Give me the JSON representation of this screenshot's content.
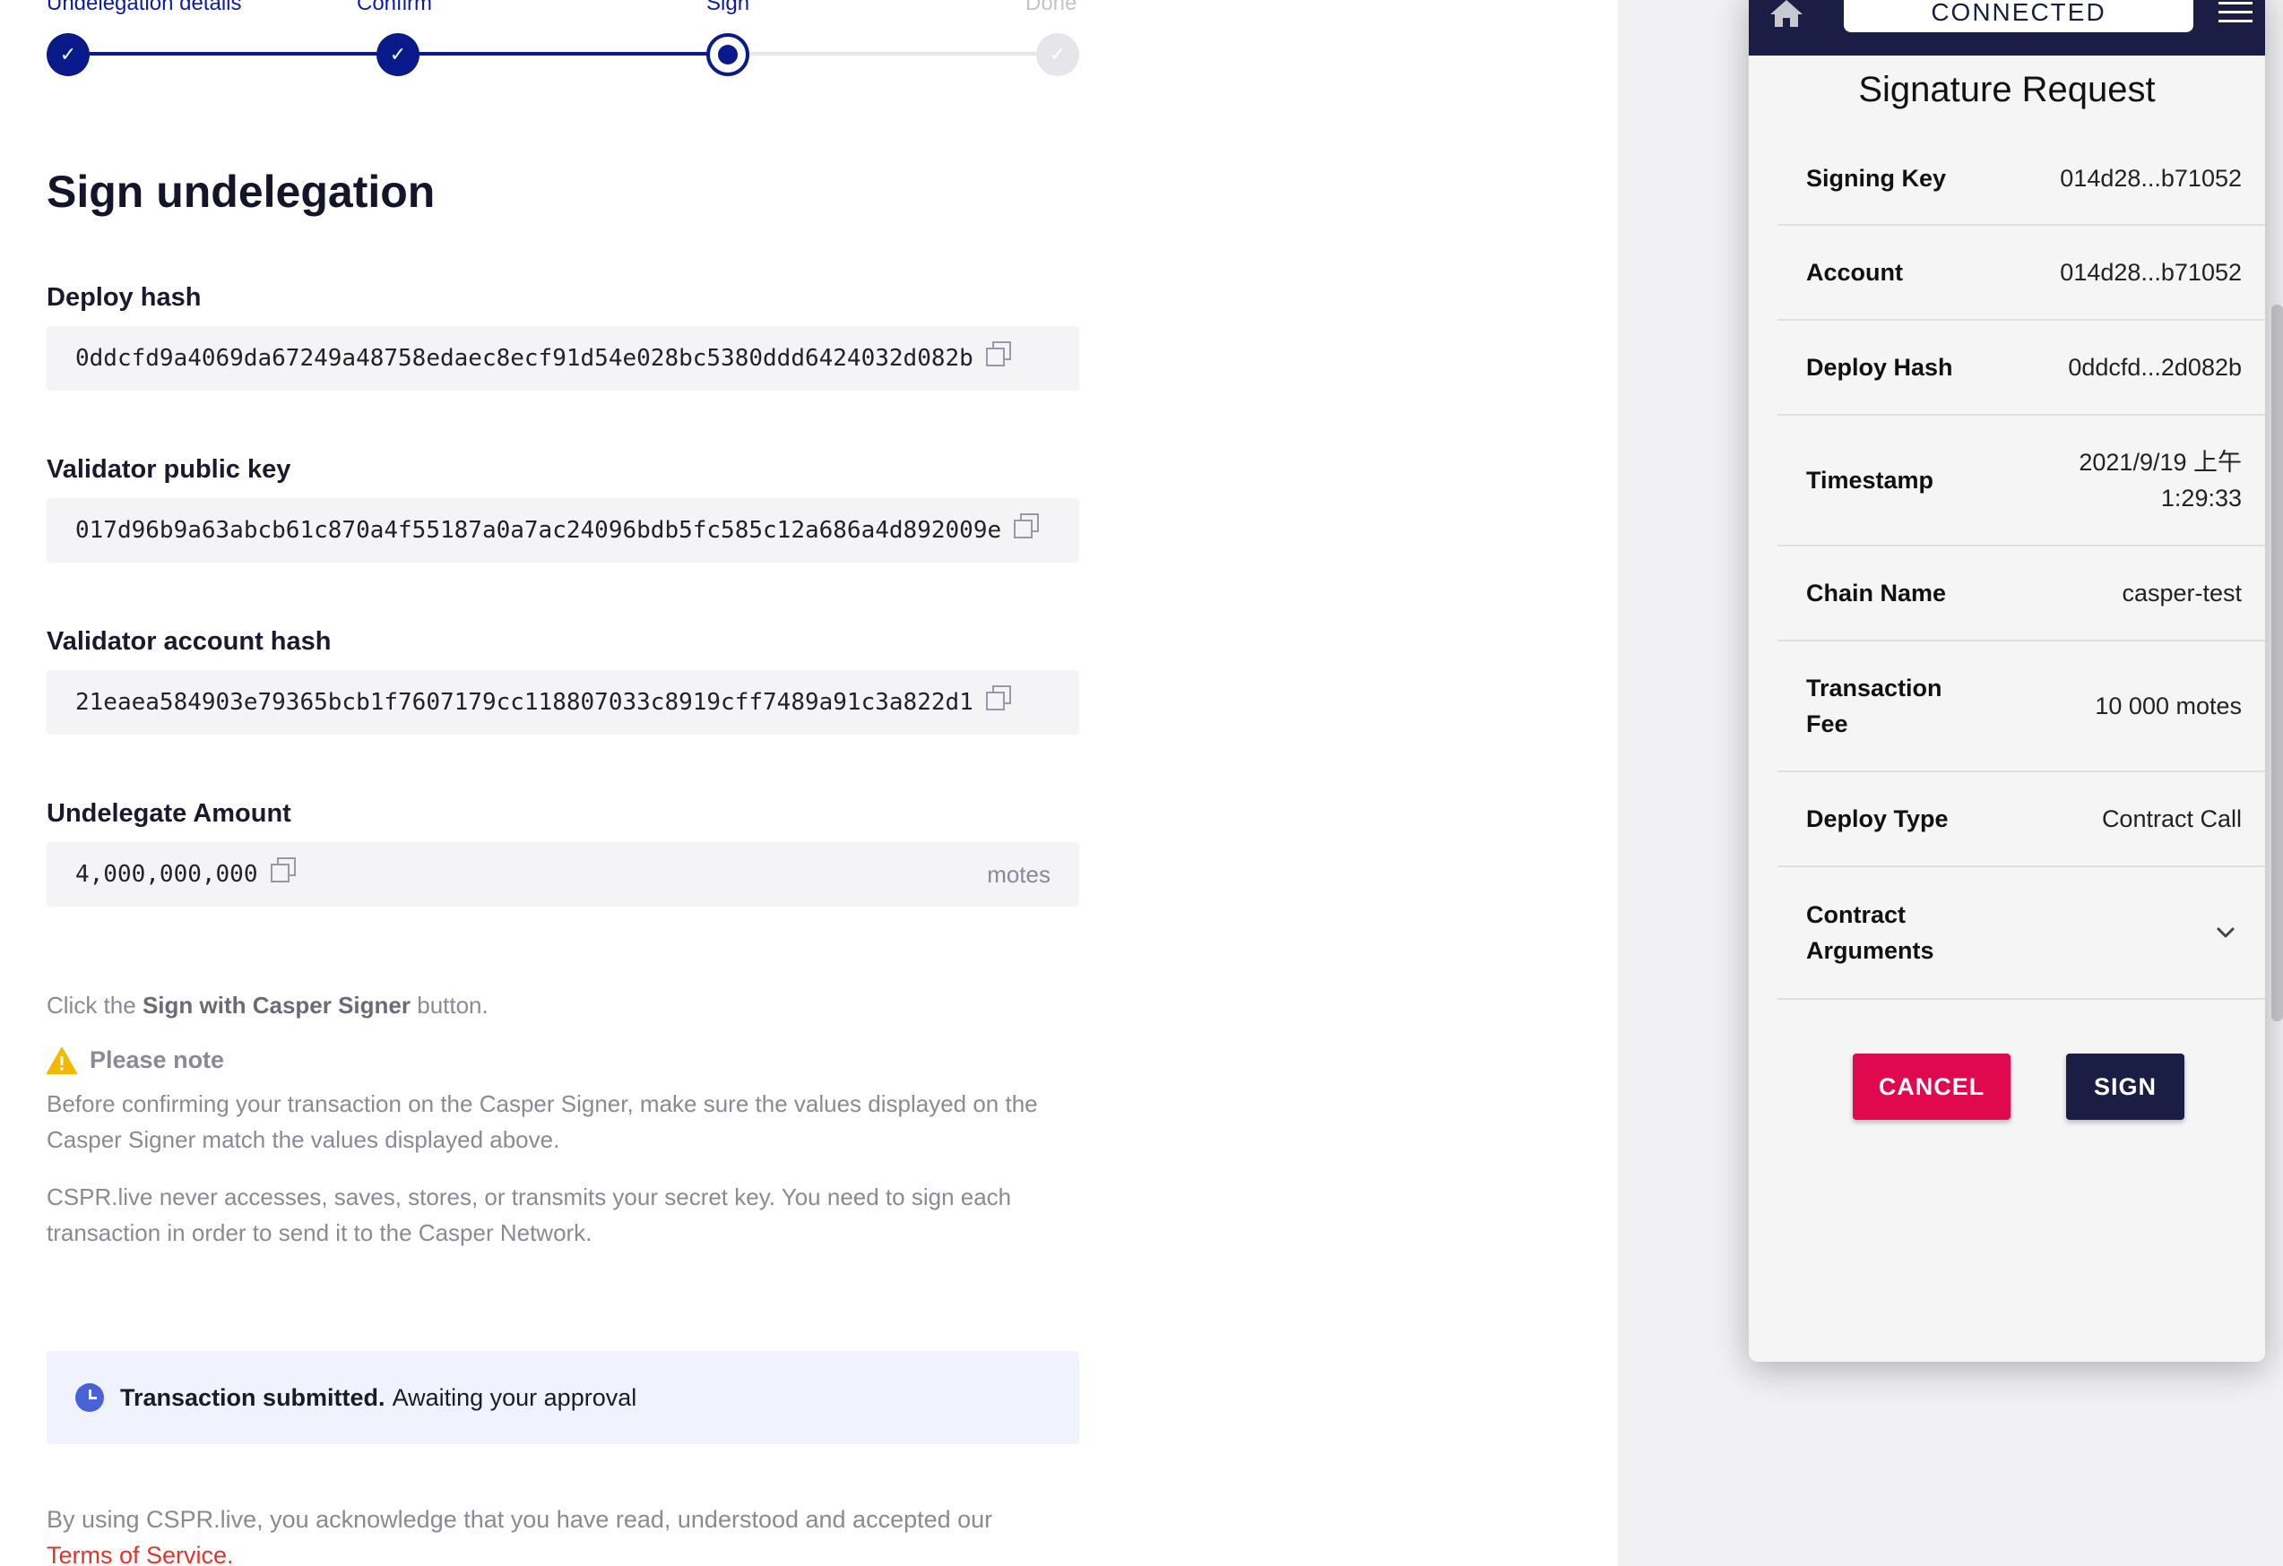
{
  "stepper": {
    "steps": [
      {
        "label": "Undelegation details",
        "state": "complete"
      },
      {
        "label": "Confirm",
        "state": "complete"
      },
      {
        "label": "Sign",
        "state": "current"
      },
      {
        "label": "Done",
        "state": "pending"
      }
    ]
  },
  "page": {
    "title": "Sign undelegation",
    "fields": {
      "deploy_hash_label": "Deploy hash",
      "deploy_hash": "0ddcfd9a4069da67249a48758edaec8ecf91d54e028bc5380ddd6424032d082b",
      "validator_public_key_label": "Validator public key",
      "validator_public_key": "017d96b9a63abcb61c870a4f55187a0a7ac24096bdb5fc585c12a686a4d892009e",
      "validator_account_hash_label": "Validator account hash",
      "validator_account_hash": "21eaea584903e79365bcb1f7607179cc118807033c8919cff7489a91c3a822d1",
      "undelegate_amount_label": "Undelegate Amount",
      "undelegate_amount": "4,000,000,000",
      "undelegate_amount_unit": "motes"
    },
    "instruction_prefix": "Click the",
    "instruction_button": "Sign with Casper Signer",
    "instruction_suffix": "button.",
    "note_title": "Please note",
    "note_p1": "Before confirming your transaction on the Casper Signer, make sure the values displayed on the Casper Signer match the values displayed above.",
    "note_p2": "CSPR.live never accesses, saves, stores, or transmits your secret key. You need to sign each transaction in order to send it to the Casper Network.",
    "status_bold": "Transaction submitted.",
    "status_text": "Awaiting your approval",
    "footer_text": "By using CSPR.live, you acknowledge that you have read, understood and accepted our",
    "footer_link": "Terms of Service."
  },
  "signer": {
    "connection": "CONNECTED",
    "title": "Signature Request",
    "rows": [
      {
        "key": "Signing Key",
        "value": "014d28...b71052"
      },
      {
        "key": "Account",
        "value": "014d28...b71052"
      },
      {
        "key": "Deploy Hash",
        "value": "0ddcfd...2d082b"
      },
      {
        "key": "Timestamp",
        "value_line1": "2021/9/19 上午",
        "value_line2": "1:29:33"
      },
      {
        "key": "Chain Name",
        "value": "casper-test"
      },
      {
        "key_line1": "Transaction",
        "key_line2": "Fee",
        "value": "10 000 motes"
      },
      {
        "key": "Deploy Type",
        "value": "Contract Call"
      },
      {
        "key_line1": "Contract",
        "key_line2": "Arguments",
        "icon": "chevron-down-icon"
      }
    ],
    "cancel_label": "CANCEL",
    "sign_label": "SIGN"
  },
  "colors": {
    "stepper_accent": "#0a1a8a",
    "cancel": "#e0094f",
    "signer_dark": "#1b1e44",
    "link": "#e0352b",
    "warning": "#f5b800",
    "info": "#4a62d8"
  }
}
